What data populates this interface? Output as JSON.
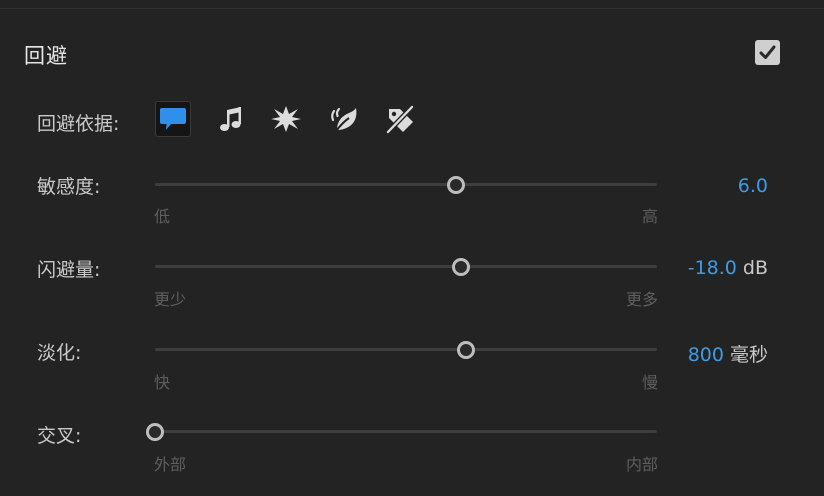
{
  "panel": {
    "title": "回避",
    "enabled": true
  },
  "duck_against": {
    "label": "回避依据:",
    "options": [
      {
        "icon": "speech-bubble-icon",
        "selected": true
      },
      {
        "icon": "music-note-icon",
        "selected": false
      },
      {
        "icon": "sound-effects-burst-icon",
        "selected": false
      },
      {
        "icon": "ambience-icon",
        "selected": false
      },
      {
        "icon": "untagged-audio-icon",
        "selected": false
      }
    ]
  },
  "sliders": {
    "sensitivity": {
      "label": "敏感度:",
      "min_label": "低",
      "max_label": "高",
      "value": "6.0",
      "unit": "",
      "level": 0.6
    },
    "duck_amount": {
      "label": "闪避量:",
      "min_label": "更少",
      "max_label": "更多",
      "value": "-18.0",
      "unit": "dB",
      "level": 0.61
    },
    "fades": {
      "label": "淡化:",
      "min_label": "快",
      "max_label": "慢",
      "value": "800",
      "unit": "毫秒",
      "level": 0.62
    },
    "crossover": {
      "label": "交叉:",
      "min_label": "外部",
      "max_label": "内部",
      "value": "",
      "unit": "",
      "level": 0.0
    }
  },
  "colors": {
    "accent": "#3b9ce6",
    "background": "#232323",
    "selected_icon": "#2f8fea"
  }
}
